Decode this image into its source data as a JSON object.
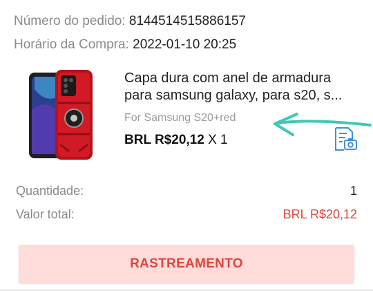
{
  "order": {
    "number_label": "Número do pedido:",
    "number_value": "8144514515886157",
    "time_label": "Horário da Compra:",
    "time_value": "2022-01-10 20:25"
  },
  "product": {
    "title": "Capa dura com anel de armadura para samsung galaxy, para s20, s...",
    "variant": "For Samsung S20+red",
    "price": "BRL R$20,12",
    "quantity_text": "X 1",
    "image_icon": "phone-case-image",
    "action_icon": "document-camera-icon"
  },
  "annotation": {
    "arrow_color": "#3ec9b6"
  },
  "summary": {
    "quantity_label": "Quantidade:",
    "quantity_value": "1",
    "total_label": "Valor total:",
    "total_value": "BRL R$20,12"
  },
  "tracking_button": {
    "label": "RASTREAMENTO"
  },
  "colors": {
    "accent": "#e0453b",
    "button_bg": "#fddcda",
    "icon_blue": "#3f8fd9"
  }
}
